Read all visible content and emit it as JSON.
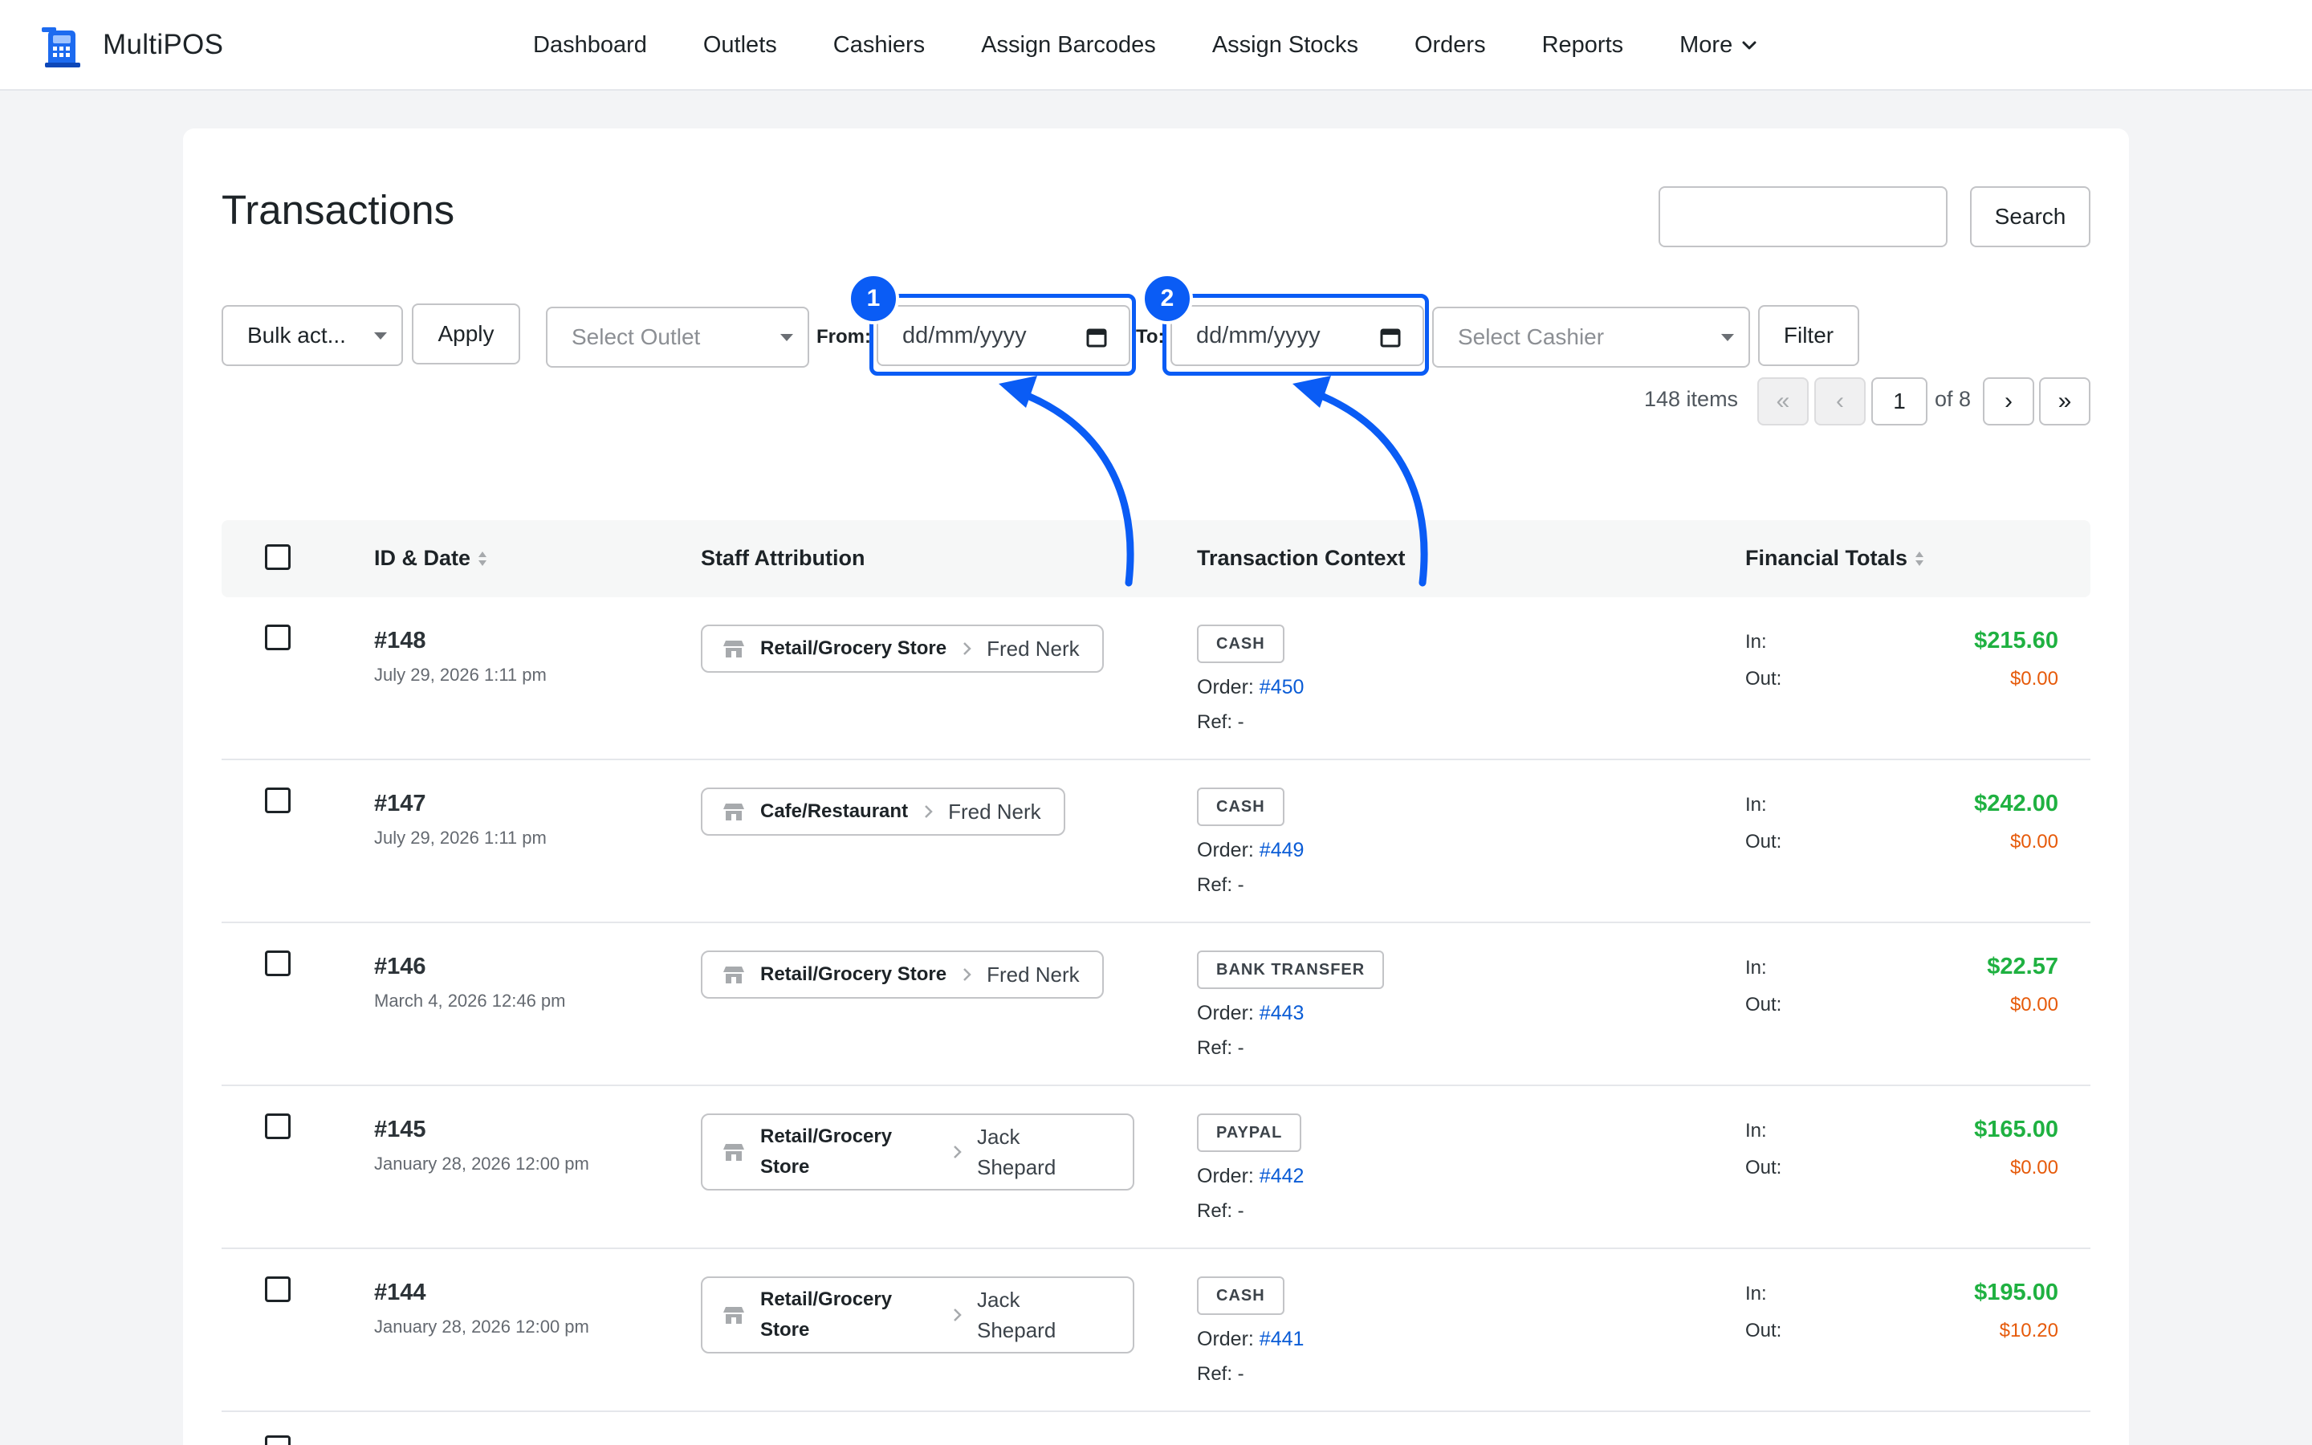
{
  "app": {
    "name": "MultiPOS"
  },
  "nav": {
    "items": [
      "Dashboard",
      "Outlets",
      "Cashiers",
      "Assign Barcodes",
      "Assign Stocks",
      "Orders",
      "Reports",
      "More"
    ]
  },
  "page": {
    "title": "Transactions",
    "search_button": "Search",
    "search_value": ""
  },
  "filters": {
    "bulk_action": "Bulk act...",
    "apply_label": "Apply",
    "outlet_placeholder": "Select Outlet",
    "from_label": "From:",
    "from_placeholder": "dd/mm/yyyy",
    "to_label": "To:",
    "to_placeholder": "dd/mm/yyyy",
    "cashier_placeholder": "Select Cashier",
    "filter_label": "Filter"
  },
  "annotations": {
    "badge_1": "1",
    "badge_2": "2",
    "accent_color": "#0a5cf5"
  },
  "pagination": {
    "count": "148 items",
    "first": "«",
    "prev": "‹",
    "current": "1",
    "of": "of 8",
    "next": "›",
    "last": "»"
  },
  "table": {
    "headers": {
      "id_date": "ID & Date",
      "staff": "Staff Attribution",
      "context": "Transaction Context",
      "totals": "Financial Totals"
    },
    "order_prefix": "Order: ",
    "ref_label": "Ref: -",
    "in_label": "In:",
    "out_label": "Out:",
    "rows": [
      {
        "id": "#148",
        "date": "July 29, 2026 1:11 pm",
        "outlet": "Retail/Grocery Store",
        "cashier": "Fred Nerk",
        "method": "CASH",
        "order": "#450",
        "in": "$215.60",
        "out": "$0.00"
      },
      {
        "id": "#147",
        "date": "July 29, 2026 1:11 pm",
        "outlet": "Cafe/Restaurant",
        "cashier": "Fred Nerk",
        "method": "CASH",
        "order": "#449",
        "in": "$242.00",
        "out": "$0.00"
      },
      {
        "id": "#146",
        "date": "March 4, 2026 12:46 pm",
        "outlet": "Retail/Grocery Store",
        "cashier": "Fred Nerk",
        "method": "BANK TRANSFER",
        "order": "#443",
        "in": "$22.57",
        "out": "$0.00"
      },
      {
        "id": "#145",
        "date": "January 28, 2026 12:00 pm",
        "outlet": "Retail/Grocery Store",
        "cashier": "Jack Shepard",
        "method": "PAYPAL",
        "order": "#442",
        "in": "$165.00",
        "out": "$0.00"
      },
      {
        "id": "#144",
        "date": "January 28, 2026 12:00 pm",
        "outlet": "Retail/Grocery Store",
        "cashier": "Jack Shepard",
        "method": "CASH",
        "order": "#441",
        "in": "$195.00",
        "out": "$10.20"
      }
    ]
  }
}
